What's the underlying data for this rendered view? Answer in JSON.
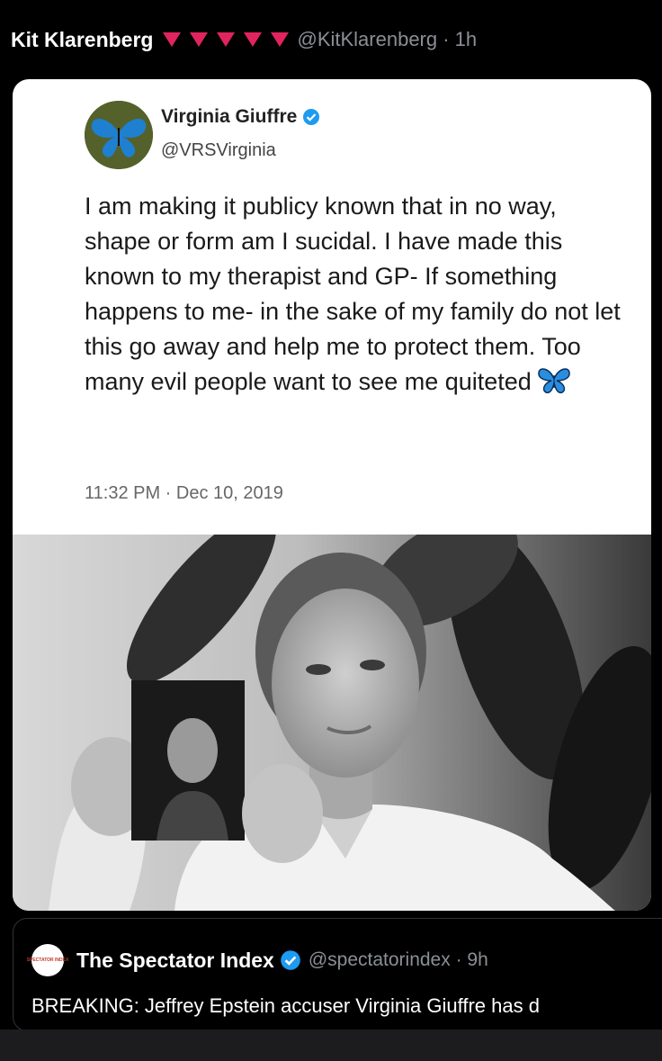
{
  "post": {
    "author_name": "Kit Klarenberg",
    "emoji_icons": [
      "red-down-triangle",
      "red-down-triangle",
      "red-down-triangle",
      "red-down-triangle",
      "red-down-triangle"
    ],
    "handle_meta": "@KitKlarenberg · 1h"
  },
  "quoted_tweet": {
    "name": "Virginia Giuffre",
    "handle": "@VRSVirginia",
    "text": "I am making it publicy known that in no way, shape or form am I sucidal. I have made this known to my therapist and GP- If something happens to me- in the sake of my family do not let this go away and help me to protect them. Too many evil people want to see me quiteted",
    "timestamp": "11:32 PM · Dec 10, 2019",
    "verified_color": "#1d9bf0"
  },
  "quote": {
    "avatar_text": "SPECTATOR INDEX",
    "name": "The Spectator Index",
    "meta": "@spectatorindex · 9h",
    "text": "BREAKING: Jeffrey Epstein accuser Virginia Giuffre has d"
  },
  "colors": {
    "background": "#000000",
    "card": "#ffffff",
    "accent_red": "#e0245e",
    "muted": "#8b8f95"
  }
}
